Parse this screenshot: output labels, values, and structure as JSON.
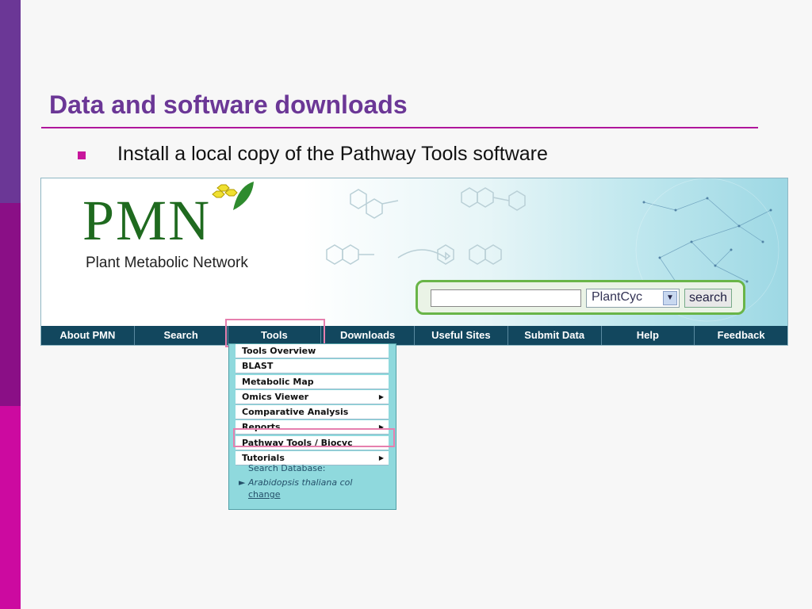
{
  "slide": {
    "title": "Data and software downloads",
    "bullet": "Install a local copy of the Pathway Tools software"
  },
  "logo": {
    "name": "PMN",
    "subtitle": "Plant Metabolic Network"
  },
  "search": {
    "input_value": "",
    "database_selected": "PlantCyc",
    "button_label": "search"
  },
  "nav": {
    "items": [
      "About PMN",
      "Search",
      "Tools",
      "Downloads",
      "Useful Sites",
      "Submit Data",
      "Help",
      "Feedback"
    ]
  },
  "tools_menu": {
    "items": [
      {
        "label": "Tools Overview",
        "submenu": false
      },
      {
        "label": "BLAST",
        "submenu": false
      },
      {
        "label": "Metabolic Map",
        "submenu": false
      },
      {
        "label": "Omics Viewer",
        "submenu": true
      },
      {
        "label": "Comparative Analysis",
        "submenu": false
      },
      {
        "label": "Reports",
        "submenu": true
      },
      {
        "label": "Pathway Tools / Biocyc Bundle",
        "submenu": false
      },
      {
        "label": "Tutorials",
        "submenu": true
      }
    ],
    "search_db_label": "Search Database:",
    "search_db_name": "Arabidopsis thaliana col",
    "change_link": "change"
  },
  "colors": {
    "title": "#6b3796",
    "nav_bg": "#12475e",
    "highlight": "#e67fae",
    "search_border": "#69b548"
  }
}
